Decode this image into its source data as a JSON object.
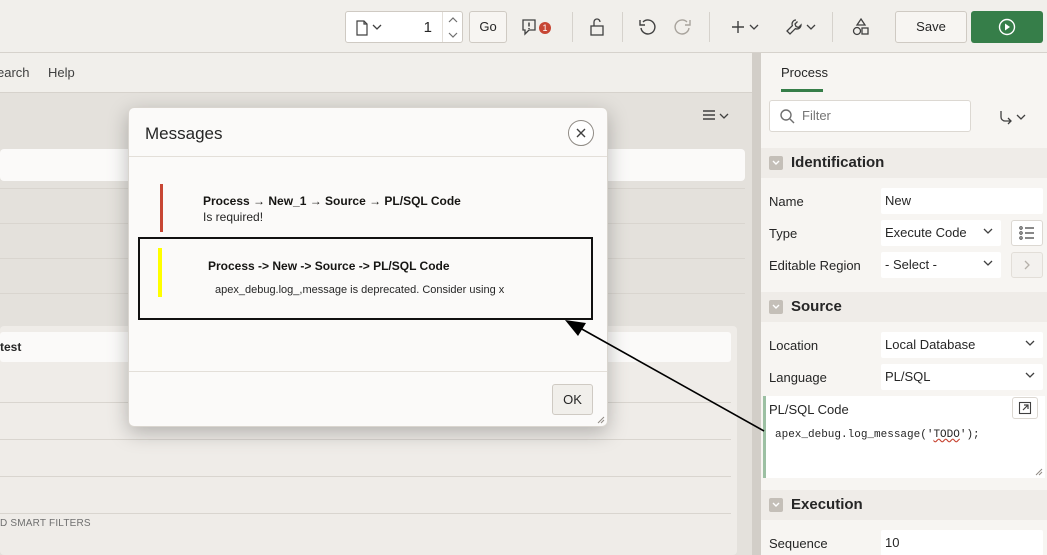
{
  "toolbar": {
    "page_number": "1",
    "go_label": "Go",
    "messages_count": "1",
    "save_label": "Save",
    "run_color": "#367e49"
  },
  "left": {
    "nav_items": [
      "earch",
      "Help"
    ],
    "region_title": "test",
    "smart_filters_label": "D SMART FILTERS"
  },
  "panel": {
    "tab_label": "Process",
    "filter_placeholder": "Filter",
    "sections": {
      "identification": "Identification",
      "source": "Source",
      "execution": "Execution"
    },
    "identification": {
      "name_label": "Name",
      "name_value": "New",
      "type_label": "Type",
      "type_value": "Execute Code",
      "editable_region_label": "Editable Region",
      "editable_region_value": "- Select -"
    },
    "source": {
      "location_label": "Location",
      "location_value": "Local Database",
      "language_label": "Language",
      "language_value": "PL/SQL",
      "code_label": "PL/SQL Code",
      "code_before": "apex_debug.log_message('",
      "code_flagged": "TODO",
      "code_after": "');"
    },
    "execution": {
      "sequence_label": "Sequence",
      "sequence_value": "10"
    }
  },
  "dialog": {
    "title": "Messages",
    "ok_label": "OK",
    "messages": [
      {
        "title": "Process → New_1 → Source → PL/SQL Code",
        "text": "Is required!",
        "color": "#c74634"
      },
      {
        "title": "Process -> New -> Source -> PL/SQL Code",
        "text": "apex_debug.log_,message is deprecated. Consider using x",
        "color": "#ffff00"
      }
    ]
  }
}
